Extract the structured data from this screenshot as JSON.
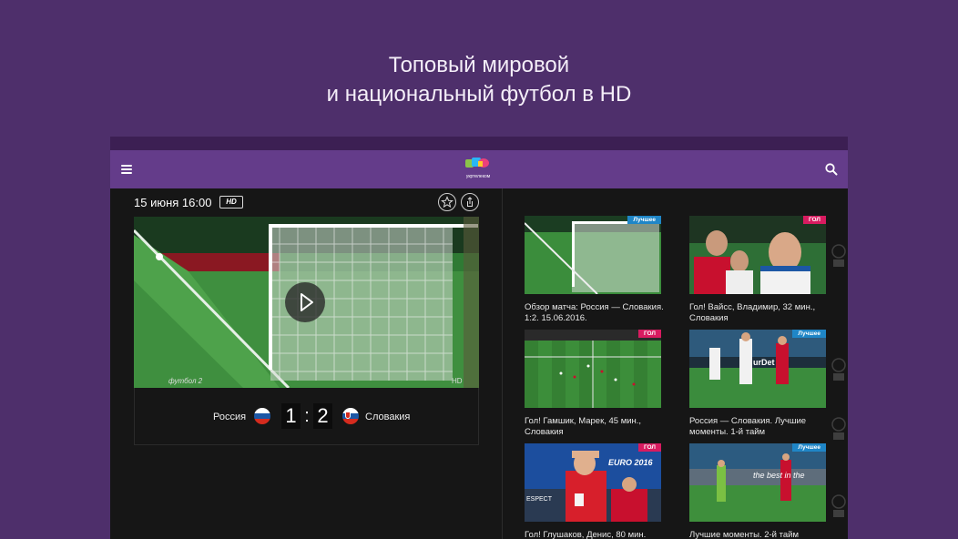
{
  "headline": {
    "line1": "Топовый мировой",
    "line2": "и национальный футбол в HD"
  },
  "appbar": {
    "menu_icon": "hamburger-menu-icon",
    "logo_icon": "app-logo-icon",
    "logo_text": "укртелеком",
    "search_icon": "search-icon"
  },
  "match": {
    "date": "15 июня 16:00",
    "hd_label": "HD",
    "favorite_icon": "star-icon",
    "share_icon": "share-icon",
    "play_icon": "play-icon",
    "home_team": "Россия",
    "away_team": "Словакия",
    "home_score": "1",
    "away_score": "2",
    "score_separator": ":",
    "video_overlay": "футбол 2",
    "video_hd": "HD"
  },
  "videos": [
    {
      "title": "Обзор матча: Россия — Словакия. 1:2. 15.06.2016.",
      "tag": "Лучшее",
      "tag_type": "best"
    },
    {
      "title": "Гол! Вайсс, Владимир, 32 мин., Словакия",
      "tag": "ГОЛ",
      "tag_type": "goal"
    },
    {
      "title": "Гол! Гамшик, Марек, 45 мин., Словакия",
      "tag": "ГОЛ",
      "tag_type": "goal"
    },
    {
      "title": "Россия — Словакия. Лучшие моменты. 1-й тайм",
      "tag": "Лучшее",
      "tag_type": "best"
    },
    {
      "title": "Гол! Глушаков, Денис, 80 мин.",
      "tag": "ГОЛ",
      "tag_type": "goal"
    },
    {
      "title": "Лучшие моменты. 2-й тайм",
      "tag": "Лучшее",
      "tag_type": "best"
    }
  ],
  "thumb_texts": {
    "euro": "EURO 2016",
    "board": "the best in the",
    "espect": "ESPECT",
    "bet": "urDet"
  },
  "colors": {
    "background": "#4e2f6b",
    "appbar": "#643c8a",
    "best_tag": "#1f86c7",
    "goal_tag": "#d81b60"
  }
}
